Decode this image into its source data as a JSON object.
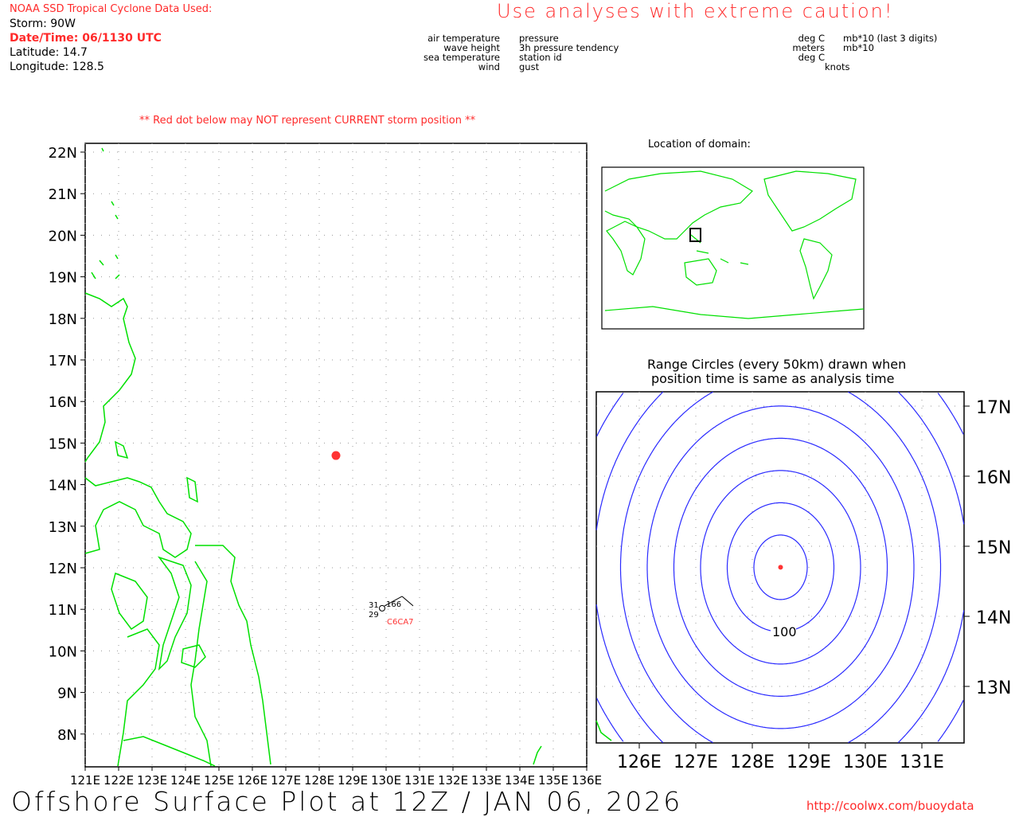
{
  "header": {
    "source": "NOAA SSD Tropical Cyclone Data Used:",
    "storm": "Storm: 90W",
    "datetime": "Date/Time: 06/1130 UTC",
    "latitude": "Latitude: 14.7",
    "longitude": "Longitude: 128.5",
    "caution": "Use analyses with extreme caution!"
  },
  "legend": {
    "left": [
      "air temperature",
      "wave height",
      "sea temperature"
    ],
    "right": [
      "pressure",
      "3h pressure tendency",
      "station id"
    ],
    "bottom_left": "wind",
    "bottom_right": "gust",
    "units_left": [
      "deg C",
      "meters",
      "deg C"
    ],
    "units_right": [
      "mb*10 (last 3 digits)",
      "mb*10",
      "knots"
    ]
  },
  "warning": "** Red dot below may NOT represent CURRENT storm position **",
  "main_map": {
    "lat_labels": [
      "22N",
      "21N",
      "20N",
      "19N",
      "18N",
      "17N",
      "16N",
      "15N",
      "14N",
      "13N",
      "12N",
      "11N",
      "10N",
      "9N",
      "8N"
    ],
    "lon_labels": [
      "121E",
      "122E",
      "123E",
      "124E",
      "125E",
      "126E",
      "127E",
      "128E",
      "129E",
      "130E",
      "131E",
      "132E",
      "133E",
      "134E",
      "135E",
      "136E"
    ],
    "storm": {
      "lat": 14.7,
      "lon": 128.5
    },
    "station": {
      "air_temp": "31",
      "sea_temp": "29",
      "pressure": "166",
      "id": "C6CA7",
      "lat": 11.6,
      "lon": 130.0
    }
  },
  "inset": {
    "title": "Location of domain:"
  },
  "range": {
    "title1": "Range Circles (every 50km) drawn when",
    "title2": "position time is same as analysis time",
    "label": "100",
    "lat_labels": [
      "17N",
      "16N",
      "15N",
      "14N",
      "13N"
    ],
    "lon_labels": [
      "126E",
      "127E",
      "128E",
      "129E",
      "130E",
      "131E"
    ]
  },
  "footer": {
    "title": "Offshore Surface Plot at 12Z / JAN 06, 2026",
    "url": "http://coolwx.com/buoydata"
  },
  "colors": {
    "land": "#00e000",
    "storm": "#ff3333",
    "circles": "#2a2aff",
    "text_red": "#ff2a2a"
  }
}
